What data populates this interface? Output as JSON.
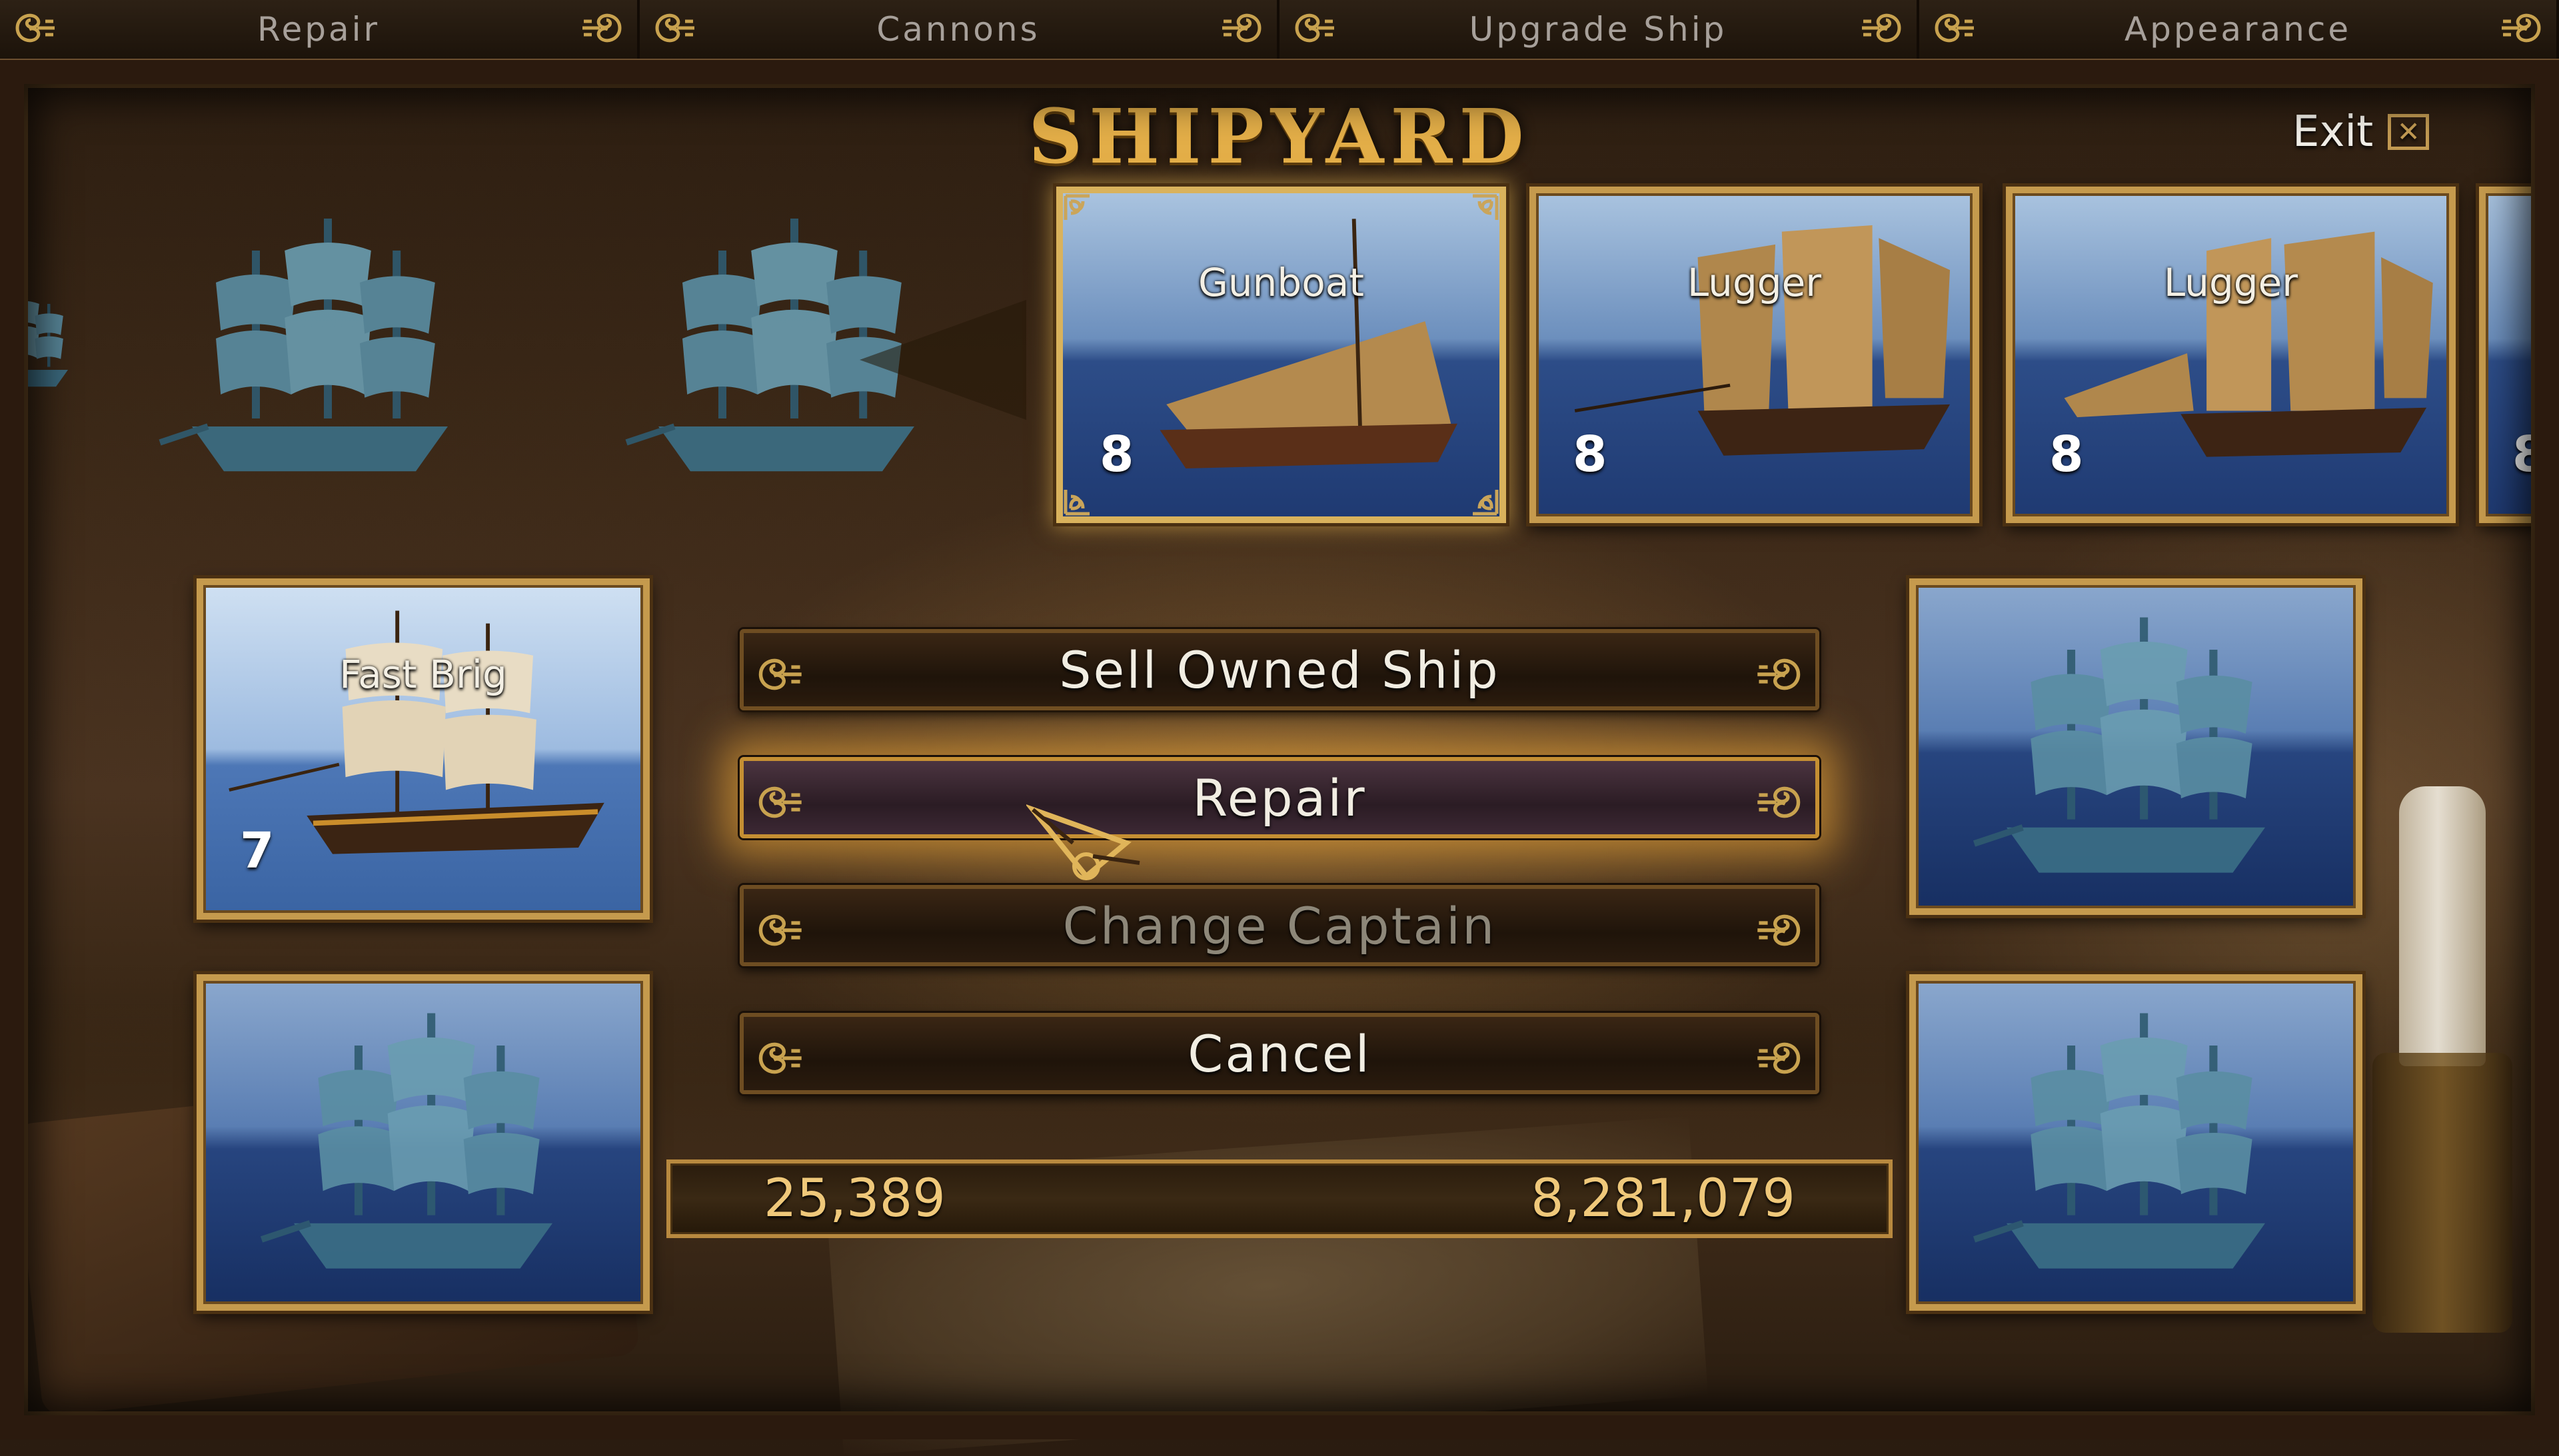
{
  "tabs": [
    {
      "label": "Repair"
    },
    {
      "label": "Cannons"
    },
    {
      "label": "Upgrade Ship"
    },
    {
      "label": "Appearance"
    }
  ],
  "title": "SHIPYARD",
  "exit": {
    "label": "Exit",
    "icon": "close-icon"
  },
  "shop_ships": [
    {
      "name": "Gunboat",
      "level": "8",
      "selected": true
    },
    {
      "name": "Lugger",
      "level": "8"
    },
    {
      "name": "Lugger",
      "level": "8"
    },
    {
      "name": "",
      "level": "8"
    }
  ],
  "owned_ship": {
    "name": "Fast Brig",
    "level": "7"
  },
  "menu": {
    "sell": "Sell Owned Ship",
    "repair": "Repair",
    "change_captain": "Change Captain",
    "cancel": "Cancel"
  },
  "money": {
    "left_value": "25,389",
    "right_value": "8,281,079"
  },
  "colors": {
    "gold": "#c59a4d",
    "title": "#e3ae48",
    "money_text": "#efc87a",
    "disabled_text": "#8d8779"
  }
}
